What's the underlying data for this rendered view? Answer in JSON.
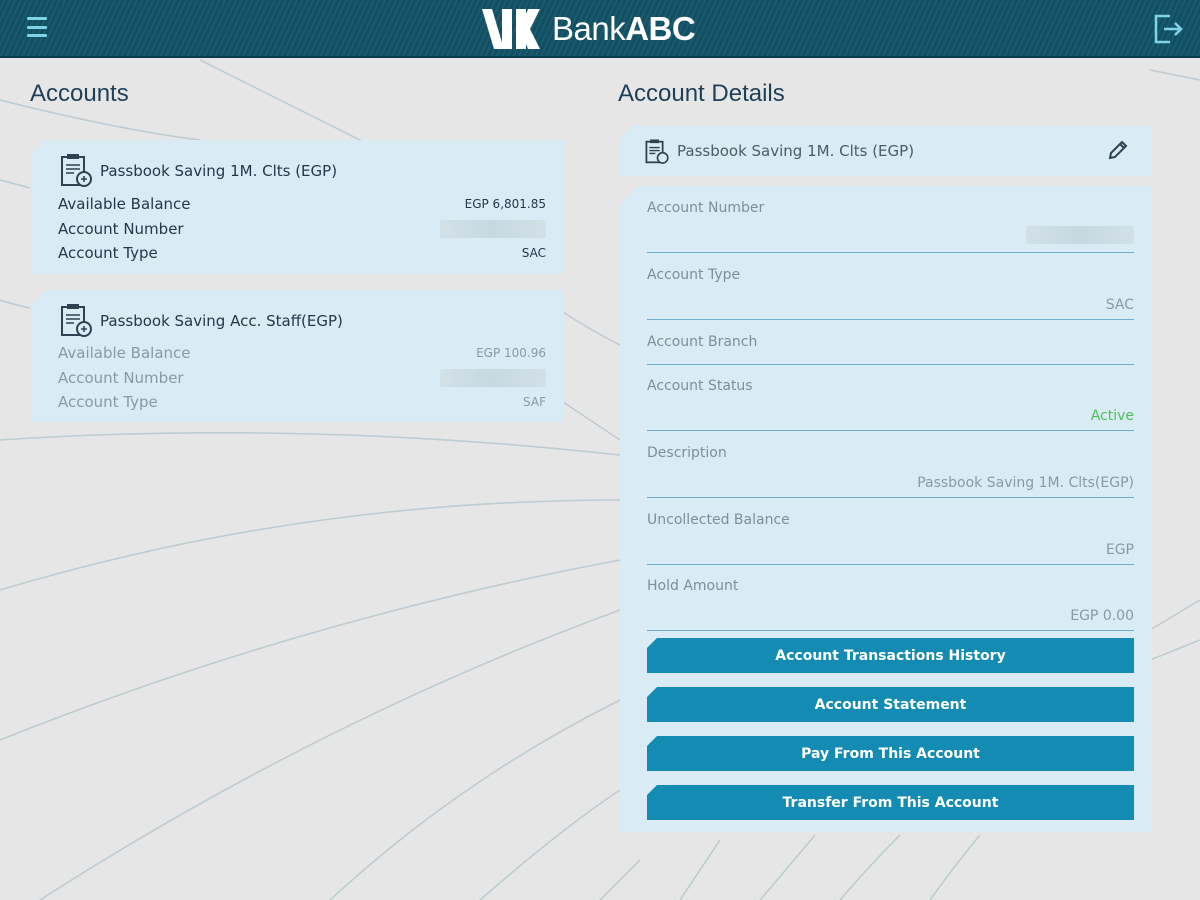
{
  "header": {
    "brand_regular": "Bank",
    "brand_bold": "ABC",
    "menu_icon": "hamburger-menu-icon",
    "logout_icon": "logout-icon"
  },
  "accounts": {
    "title": "Accounts",
    "items": [
      {
        "name": "Passbook Saving 1M. Clts (EGP)",
        "available_balance_label": "Available Balance",
        "available_balance": "EGP 6,801.85",
        "account_number_label": "Account Number",
        "account_type_label": "Account Type",
        "account_type": "SAC",
        "icon": "passbook-icon"
      },
      {
        "name": "Passbook Saving Acc. Staff(EGP)",
        "available_balance_label": "Available Balance",
        "available_balance": "EGP 100.96",
        "account_number_label": "Account Number",
        "account_type_label": "Account Type",
        "account_type": "SAF",
        "icon": "passbook-icon"
      }
    ]
  },
  "details": {
    "title": "Account Details",
    "selected_name": "Passbook Saving 1M. Clts (EGP)",
    "edit_icon": "pencil-icon",
    "fields": {
      "account_number_label": "Account Number",
      "account_type_label": "Account Type",
      "account_type": "SAC",
      "branch_label": "Account Branch",
      "status_label": "Account Status",
      "status": "Active",
      "description_label": "Description",
      "description": "Passbook Saving 1M. Clts(EGP)",
      "uncollected_label": "Uncollected Balance",
      "uncollected": "EGP",
      "hold_label": "Hold Amount",
      "hold": "EGP 0.00"
    },
    "actions": {
      "history": "Account Transactions History",
      "statement": "Account Statement",
      "pay": "Pay From This Account",
      "transfer": "Transfer From This Account"
    }
  },
  "colors": {
    "header": "#124f63",
    "accent": "#138bb3",
    "card": "#d9ebf4",
    "active": "#4fbf5a"
  }
}
